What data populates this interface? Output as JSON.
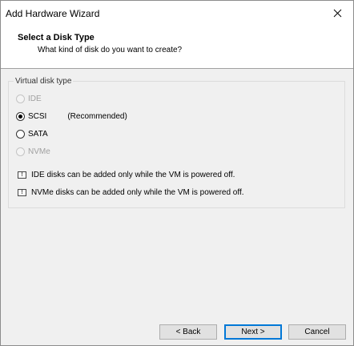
{
  "window": {
    "title": "Add Hardware Wizard",
    "close_glyph": "✕"
  },
  "header": {
    "title": "Select a Disk Type",
    "subtitle": "What kind of disk do you want to create?"
  },
  "disk_type": {
    "group_label": "Virtual disk type",
    "options": [
      {
        "label": "IDE",
        "selected": false,
        "enabled": false
      },
      {
        "label": "SCSI",
        "note": "(Recommended)",
        "selected": true,
        "enabled": true
      },
      {
        "label": "SATA",
        "selected": false,
        "enabled": true
      },
      {
        "label": "NVMe",
        "selected": false,
        "enabled": false
      }
    ]
  },
  "info": {
    "icon_glyph": "!",
    "ide_note": "IDE disks can be added only while the VM is powered off.",
    "nvme_note": "NVMe disks can be added only while the VM is powered off."
  },
  "footer": {
    "back_label": "< Back",
    "next_label": "Next >",
    "cancel_label": "Cancel"
  },
  "colors": {
    "accent": "#0078d7",
    "dialog_bg": "#f0f0f0",
    "disabled_text": "#a0a0a0"
  }
}
